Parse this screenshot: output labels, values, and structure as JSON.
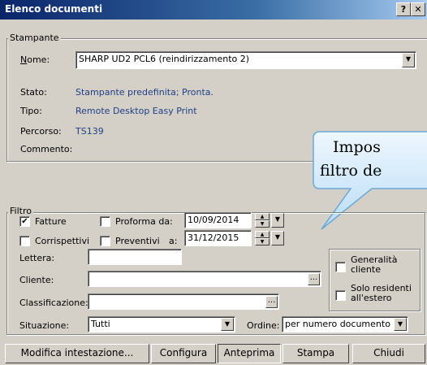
{
  "window": {
    "title": "Elenco documenti",
    "help_label": "?",
    "close_label": "✕"
  },
  "printer": {
    "group_label": "Stampante",
    "name_label": "Nome:",
    "name_value": "SHARP UD2 PCL6 (reindirizzamento 2)",
    "status_label": "Stato:",
    "status_value": "Stampante predefinita; Pronta.",
    "type_label": "Tipo:",
    "type_value": "Remote Desktop Easy Print",
    "path_label": "Percorso:",
    "path_value": "TS139",
    "comment_label": "Commento:",
    "comment_value": ""
  },
  "callout": {
    "line1": "Impos",
    "line2": "filtro de"
  },
  "filter": {
    "group_label": "Filtro",
    "invoices_label": "Fatture",
    "invoices_checked": true,
    "proforma_label": "Proforma da:",
    "proforma_checked": false,
    "date_from": "10/09/2014",
    "fees_label": "Corrispettivi",
    "fees_checked": false,
    "quotes_label": "Preventivi",
    "quotes_checked": false,
    "to_label": "a:",
    "date_to": "31/12/2015",
    "letter_label": "Lettera:",
    "letter_value": "",
    "customer_label": "Cliente:",
    "customer_value": "",
    "classification_label": "Classificazione:",
    "classification_value": "",
    "browse_label": "...",
    "generality_label": "Generalità cliente",
    "generality_checked": false,
    "foreign_label": "Solo residenti all'estero",
    "foreign_checked": false,
    "situation_label": "Situazione:",
    "situation_value": "Tutti",
    "order_label": "Ordine:",
    "order_value": "per numero documento"
  },
  "buttons": {
    "edit_header": "Modifica intestazione...",
    "configure": "Configura",
    "preview": "Anteprima",
    "print": "Stampa",
    "close": "Chiudi"
  }
}
